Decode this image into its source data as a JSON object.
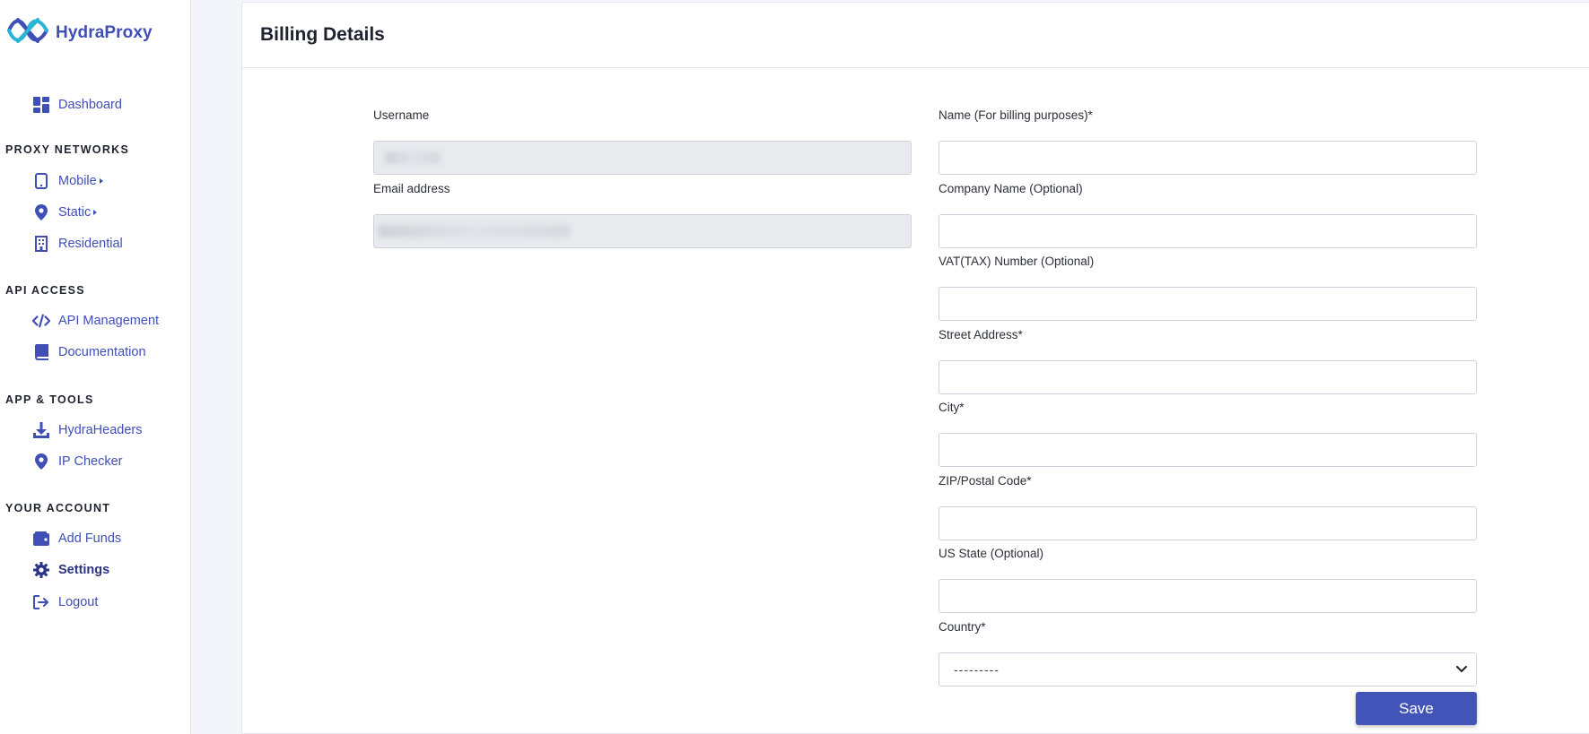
{
  "brand": {
    "name": "HydraProxy"
  },
  "sidebar": {
    "dashboard": {
      "label": "Dashboard",
      "icon": "dashboard-grid-icon"
    },
    "sections": [
      {
        "title": "PROXY NETWORKS"
      },
      {
        "title": "API ACCESS"
      },
      {
        "title": "APP & TOOLS"
      },
      {
        "title": "YOUR ACCOUNT"
      }
    ],
    "items": {
      "mobile": {
        "label": "Mobile",
        "icon": "mobile-phone-icon",
        "has_submenu": true
      },
      "static": {
        "label": "Static",
        "icon": "map-pin-icon",
        "has_submenu": true
      },
      "residential": {
        "label": "Residential",
        "icon": "building-icon"
      },
      "api_management": {
        "label": "API Management",
        "icon": "code-icon"
      },
      "documentation": {
        "label": "Documentation",
        "icon": "book-icon"
      },
      "hydraheaders": {
        "label": "HydraHeaders",
        "icon": "download-icon"
      },
      "ip_checker": {
        "label": "IP Checker",
        "icon": "map-pin-icon"
      },
      "add_funds": {
        "label": "Add Funds",
        "icon": "wallet-icon"
      },
      "settings": {
        "label": "Settings",
        "icon": "gear-icon",
        "active": true
      },
      "logout": {
        "label": "Logout",
        "icon": "logout-icon"
      }
    },
    "accent_color": "#3f4fb5"
  },
  "main": {
    "title": "Billing Details",
    "left_fields": {
      "username": {
        "label": "Username",
        "value": ""
      },
      "email": {
        "label": "Email address",
        "value": ""
      }
    },
    "right_fields": {
      "name": {
        "label": "Name (For billing purposes)*",
        "value": ""
      },
      "company": {
        "label": "Company Name (Optional)",
        "value": ""
      },
      "vat": {
        "label": "VAT(TAX) Number (Optional)",
        "value": ""
      },
      "street": {
        "label": "Street Address*",
        "value": ""
      },
      "city": {
        "label": "City*",
        "value": ""
      },
      "zip": {
        "label": "ZIP/Postal Code*",
        "value": ""
      },
      "us_state": {
        "label": "US State (Optional)",
        "value": ""
      },
      "country": {
        "label": "Country*",
        "selected": "---------"
      }
    },
    "save_label": "Save",
    "button_color": "#4354b8"
  }
}
